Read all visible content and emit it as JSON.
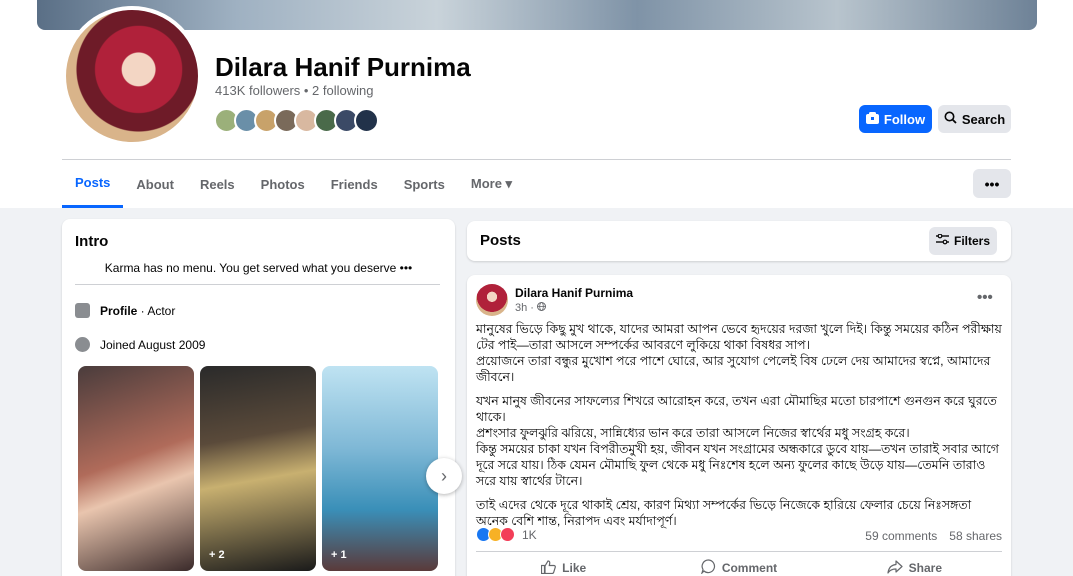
{
  "profile": {
    "name": "Dilara Hanif Purnima",
    "followers": "413K followers • 2 following"
  },
  "buttons": {
    "follow": "Follow",
    "search": "Search",
    "more_options": "•••"
  },
  "tabs": [
    "Posts",
    "About",
    "Reels",
    "Photos",
    "Friends",
    "Sports",
    "More ▾"
  ],
  "intro": {
    "title": "Intro",
    "bio": "Karma has no menu. You get served what you deserve •••",
    "profile_label": "Profile",
    "profile_value": " · Actor",
    "joined": "Joined August 2009",
    "photo2_count": "+ 2",
    "photo3_count": "+ 1"
  },
  "posts_header": {
    "title": "Posts",
    "filters": "Filters"
  },
  "post": {
    "author": "Dilara Hanif Purnima",
    "time": "3h · ",
    "menu": "•••",
    "paragraphs": [
      "মানুষের ভিড়ে কিছু মুখ থাকে, যাদের আমরা আপন ভেবে হৃদয়ের দরজা খুলে দিই। কিন্তু সময়ের কঠিন পরীক্ষায় টের পাই—তারা আসলে সম্পর্কের আবরণে লুকিয়ে থাকা বিষধর সাপ।\nপ্রয়োজনে তারা বন্ধুর মুখোশ পরে পাশে ঘোরে, আর সুযোগ পেলেই বিষ ঢেলে দেয় আমাদের স্বপ্নে, আমাদের জীবনে।",
      "যখন মানুষ জীবনের সাফল্যের শিখরে আরোহন করে, তখন এরা মৌমাছির মতো চারপাশে গুনগুন করে ঘুরতে থাকে।\nপ্রশংসার ফুলঝুরি ঝরিয়ে, সান্নিধ্যের ভান করে তারা আসলে নিজের স্বার্থের মধু সংগ্রহ করে।\nকিন্তু সময়ের চাকা যখন বিপরীতমুখী হয়, জীবন যখন সংগ্রামের অন্ধকারে ডুবে যায়—তখন তারাই সবার আগে দূরে সরে যায়। ঠিক যেমন মৌমাছি ফুল থেকে মধু নিঃশেষ হলে অন্য ফুলের কাছে উড়ে যায়—তেমনি তারাও সরে যায় স্বার্থের টানে।",
      "তাই এদের থেকে দূরে থাকাই শ্রেয়, কারণ মিথ্যা সম্পর্কের ভিড়ে নিজেকে হারিয়ে ফেলার চেয়ে নিঃসঙ্গতা অনেক বেশি শান্ত, নিরাপদ এবং মর্যাদাপূর্ণ।"
    ],
    "reaction_count": "1K",
    "comments": "59 comments",
    "shares": "58 shares",
    "actions": {
      "like": "Like",
      "comment": "Comment",
      "share": "Share"
    }
  },
  "colors": {
    "accent": "#0866ff",
    "background": "#f0f2f5",
    "like_reaction": "#1877f2",
    "haha_reaction": "#f7b125",
    "love_reaction": "#f33e58"
  }
}
